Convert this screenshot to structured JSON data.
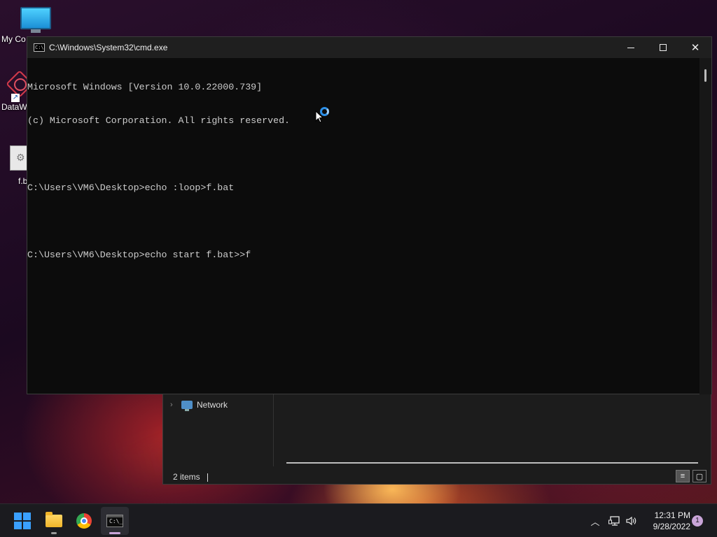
{
  "desktop": {
    "icons": [
      {
        "label": "My Co"
      },
      {
        "label": "DataW"
      },
      {
        "label": "f.b"
      }
    ]
  },
  "cmd_window": {
    "title": "C:\\Windows\\System32\\cmd.exe",
    "icon_text": "C:\\",
    "lines": [
      "Microsoft Windows [Version 10.0.22000.739]",
      "(c) Microsoft Corporation. All rights reserved.",
      "",
      "C:\\Users\\VM6\\Desktop>echo :loop>f.bat",
      "",
      "C:\\Users\\VM6\\Desktop>echo start f.bat>>f"
    ],
    "controls": {
      "minimize": "minimize-icon",
      "maximize": "maximize-icon",
      "close": "close-icon"
    }
  },
  "explorer_window": {
    "nav_item": "Network",
    "status": "2 items"
  },
  "taskbar": {
    "apps": [
      "start-icon",
      "file-explorer-icon",
      "chrome-icon",
      "terminal-icon"
    ],
    "active_app": "terminal-icon",
    "tray": {
      "time": "12:31 PM",
      "date": "9/28/2022",
      "notification_count": "1"
    }
  },
  "colors": {
    "console_bg": "#0c0c0c",
    "console_text": "#cccccc",
    "accent": "#3aa0ff",
    "taskbar_bg": "#1b1b1f"
  }
}
